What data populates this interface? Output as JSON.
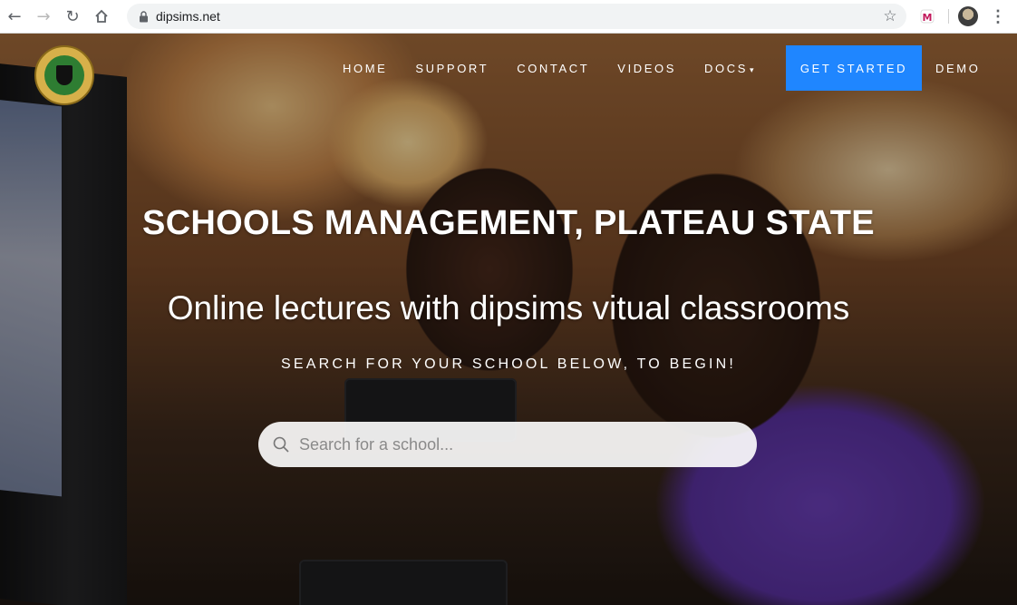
{
  "browser": {
    "url": "dipsims.net",
    "back_icon": "←",
    "forward_icon": "→",
    "reload_icon": "↻",
    "home_icon": "home-icon",
    "star_icon": "☆",
    "menu_icon": "⋮"
  },
  "header": {
    "nav": [
      "HOME",
      "SUPPORT",
      "CONTACT",
      "VIDEOS",
      "DOCS"
    ],
    "docs_caret": "▾",
    "cta_label": "GET STARTED",
    "demo_label": "DEMO"
  },
  "hero": {
    "title": "SCHOOLS MANAGEMENT, PLATEAU STATE",
    "subtitle": "Online lectures with dipsims vitual classrooms",
    "tagline": "SEARCH FOR YOUR SCHOOL BELOW, TO BEGIN!",
    "search_placeholder": "Search for a school..."
  },
  "colors": {
    "cta": "#1f86ff",
    "logo_gold": "#d7b04a",
    "logo_green": "#2e7d32"
  }
}
